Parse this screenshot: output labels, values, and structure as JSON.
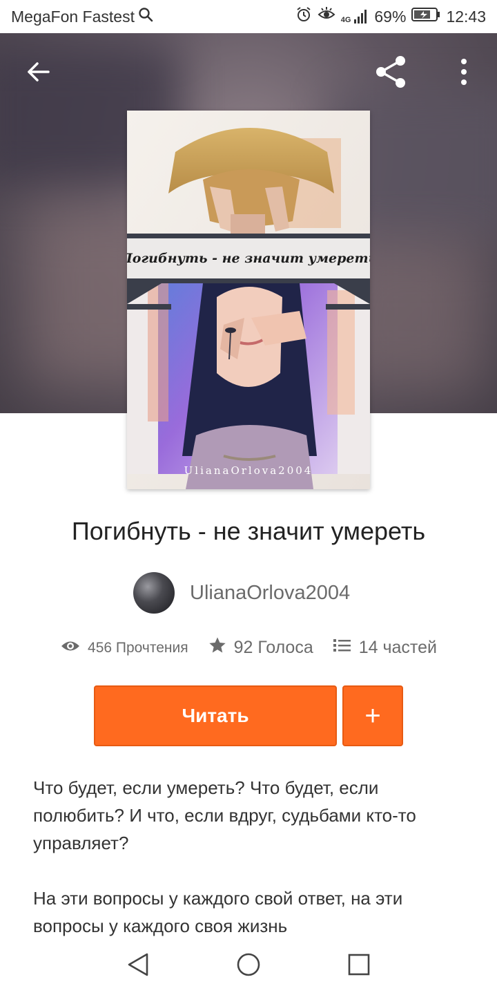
{
  "status_bar": {
    "carrier": "MegaFon Fastest",
    "network": "4G",
    "battery": "69%",
    "time": "12:43"
  },
  "header": {
    "back_icon": "arrow-left-icon",
    "share_icon": "share-icon",
    "more_icon": "more-vertical-icon"
  },
  "cover": {
    "title_text": "Погибнуть - не значит умереть",
    "signature": "UlianaOrlova2004"
  },
  "story": {
    "title": "Погибнуть - не значит умереть",
    "author": "UlianaOrlova2004",
    "stats": {
      "reads": "456 Прочтения",
      "votes": "92 Голоса",
      "parts": "14 частей"
    },
    "read_label": "Читать",
    "add_label": "+",
    "description": [
      "Что будет, если умереть? Что будет, если полюбить? И что, если вдруг, судьбами кто-то управляет?",
      "На эти вопросы у каждого свой ответ, на эти вопросы у каждого своя жизнь"
    ]
  },
  "colors": {
    "accent": "#ff6a1f",
    "text_muted": "#6b6b6b"
  }
}
